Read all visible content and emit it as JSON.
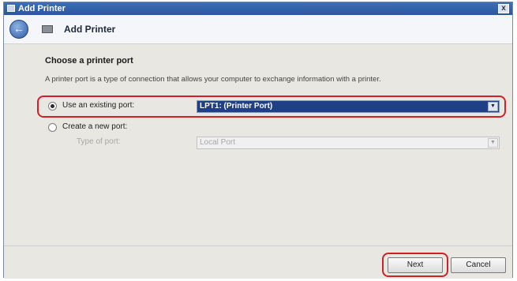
{
  "window": {
    "title": "Add Printer",
    "close_glyph": "x"
  },
  "nav": {
    "back_icon": "back-arrow-icon",
    "title": "Add Printer"
  },
  "content": {
    "heading": "Choose a printer port",
    "description": "A printer port is a type of connection that allows your computer to exchange information with a printer.",
    "option_existing": {
      "label": "Use an existing port:",
      "selected": true,
      "value": "LPT1: (Printer Port)"
    },
    "option_new": {
      "label": "Create a new port:",
      "selected": false,
      "type_label": "Type of port:",
      "value": "Local Port"
    }
  },
  "buttons": {
    "next": "Next",
    "cancel": "Cancel"
  },
  "colors": {
    "highlight": "#d0202a",
    "selection": "#1f3f87"
  }
}
